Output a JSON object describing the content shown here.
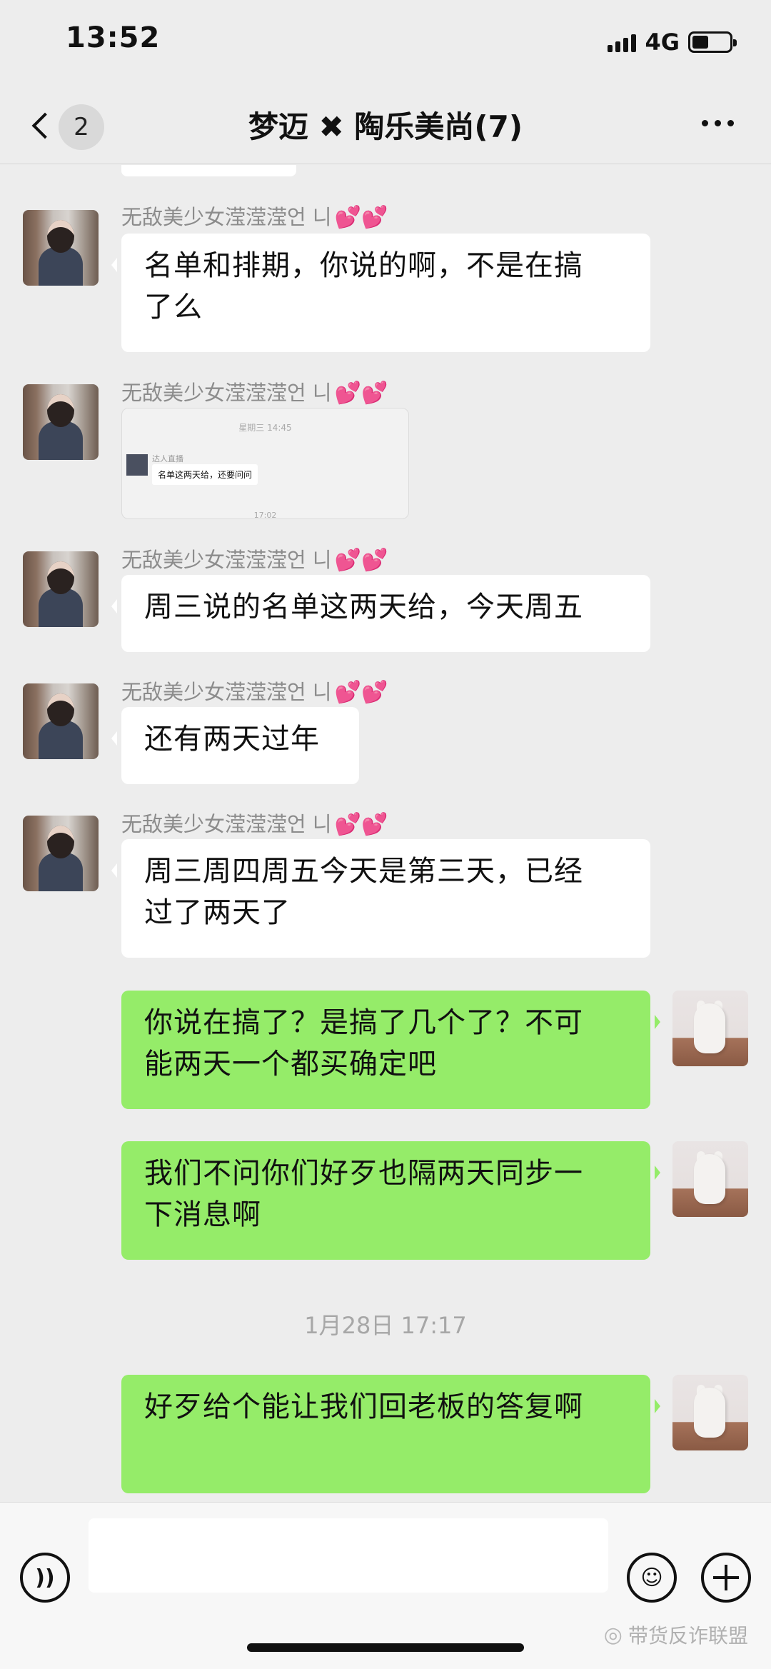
{
  "status_bar": {
    "time": "13:52",
    "network": "4G"
  },
  "nav": {
    "unread_count": "2",
    "title": "梦迈 ✖ 陶乐美尚(7)"
  },
  "messages": [
    {
      "sender": "无敌美少女滢滢滢언 니",
      "hearts": "💕💕",
      "text_lines": [
        "名单和排期，你说的啊，不是在搞",
        "了么"
      ]
    },
    {
      "sender": "无敌美少女滢滢滢언 니",
      "hearts": "💕💕",
      "image": {
        "timestamp": "星期三 14:45",
        "name": "达人直播",
        "text": "名单这两天给，还要问问",
        "timestamp2": "17:02"
      }
    },
    {
      "sender": "无敌美少女滢滢滢언 니",
      "hearts": "💕💕",
      "text_lines": [
        "周三说的名单这两天给，今天周五"
      ]
    },
    {
      "sender": "无敌美少女滢滢滢언 니",
      "hearts": "💕💕",
      "text_lines": [
        "还有两天过年"
      ]
    },
    {
      "sender": "无敌美少女滢滢滢언 니",
      "hearts": "💕💕",
      "text_lines": [
        "周三周四周五今天是第三天，已经",
        "过了两天了"
      ]
    },
    {
      "text_lines": [
        "你说在搞了？是搞了几个了？不可",
        "能两天一个都买确定吧"
      ]
    },
    {
      "text_lines": [
        "我们不问你们好歹也隔两天同步一",
        "下消息啊"
      ]
    },
    {
      "text_lines": [
        "好歹给个能让我们回老板的答复啊"
      ]
    }
  ],
  "time_divider": "1月28日 17:17",
  "watermark": "带货反诈联盟"
}
